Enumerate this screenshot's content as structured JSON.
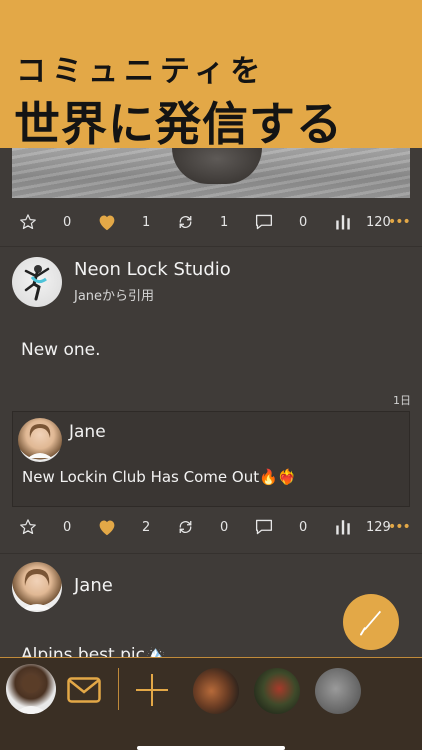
{
  "banner": {
    "subtitle": "コミュニティを",
    "title": "世界に発信する"
  },
  "post1": {
    "actions": {
      "star": "0",
      "like": "1",
      "repost": "1",
      "comment": "0",
      "views": "120"
    }
  },
  "post2": {
    "author": "Neon Lock Studio",
    "quoted_from": "Janeから引用",
    "text": "New one.",
    "time": "1日",
    "quote": {
      "author": "Jane",
      "text": "New Lockin Club Has Come Out🔥❤️‍🔥"
    },
    "actions": {
      "star": "0",
      "like": "2",
      "repost": "0",
      "comment": "0",
      "views": "129"
    }
  },
  "post3": {
    "author": "Jane",
    "text": "Alpins best pic🏔️"
  },
  "colors": {
    "accent": "#e3a847",
    "background": "#3f3b38",
    "bottom_bar": "#3a2f24"
  }
}
